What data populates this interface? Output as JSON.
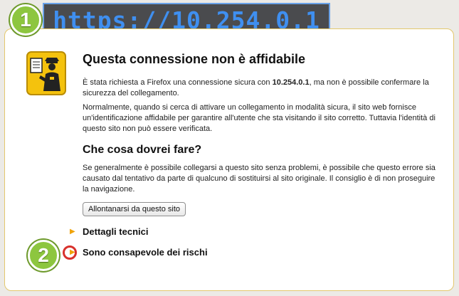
{
  "url_banner": {
    "text": "https://10.254.0.1"
  },
  "badges": {
    "first": "1",
    "second": "2"
  },
  "page": {
    "title": "Questa connessione non è affidabile",
    "para1_pre": "È stata richiesta a Firefox una connessione sicura con ",
    "para1_host": "10.254.0.1",
    "para1_post": ", ma non è possibile confermare la sicurezza del collegamento.",
    "para2": "Normalmente, quando si cerca di attivare un collegamento in modalità sicura, il sito web fornisce un'identificazione affidabile per garantire all'utente che sta visitando il sito corretto. Tuttavia l'identità di questo sito non può essere verificata.",
    "subtitle": "Che cosa dovrei fare?",
    "para3": "Se generalmente è possibile collegarsi a questo sito senza problemi, è possibile che questo errore sia causato dal tentativo da parte di qualcuno di sostituirsi al sito originale. Il consiglio è di non proseguire la navigazione.",
    "leave_button": "Allontanarsi da questo sito",
    "expanders": [
      {
        "arrow": "▶",
        "label": "Dettagli tecnici"
      },
      {
        "arrow": "▶",
        "label": "Sono consapevole dei rischi"
      }
    ]
  },
  "icons": {
    "warning": "police-officer-warning-icon",
    "expander_arrow": "triangle-right-icon"
  },
  "colors": {
    "url_text": "#3f8ff0",
    "url_background": "#4a4b4e",
    "badge_green": "#8dc63f",
    "card_border": "#e3c76c",
    "expander_arrow": "#f0a30a",
    "highlight_ring": "#d8312c"
  }
}
